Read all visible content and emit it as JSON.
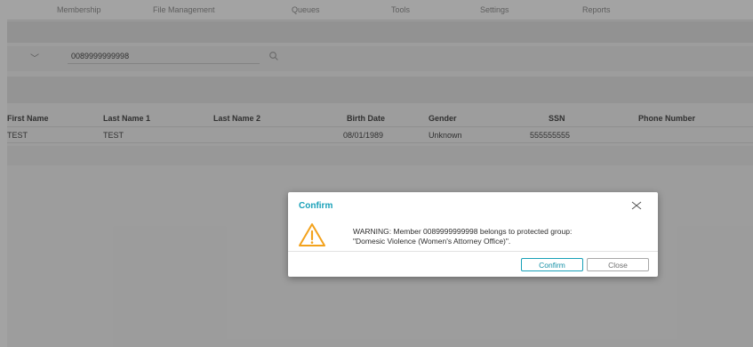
{
  "nav": {
    "items": [
      {
        "label": "Membership"
      },
      {
        "label": "File Management"
      },
      {
        "label": "Queues"
      },
      {
        "label": "Tools"
      },
      {
        "label": "Settings"
      },
      {
        "label": "Reports"
      }
    ]
  },
  "search": {
    "value": "0089999999998"
  },
  "table": {
    "columns": [
      "First Name",
      "Last Name 1",
      "Last Name 2",
      "Birth Date",
      "Gender",
      "SSN",
      "Phone Number"
    ],
    "rows": [
      [
        "TEST",
        "TEST",
        "",
        "08/01/1989",
        "Unknown",
        "555555555",
        ""
      ]
    ]
  },
  "modal": {
    "title": "Confirm",
    "message_line1": "WARNING: Member 0089999999998 belongs to protected group:",
    "message_line2": "\"Domesic Violence (Women's Attorney Office)\".",
    "confirm_label": "Confirm",
    "close_label": "Close"
  },
  "colors": {
    "accent": "#18a0b8",
    "warning": "#f3a21c"
  }
}
